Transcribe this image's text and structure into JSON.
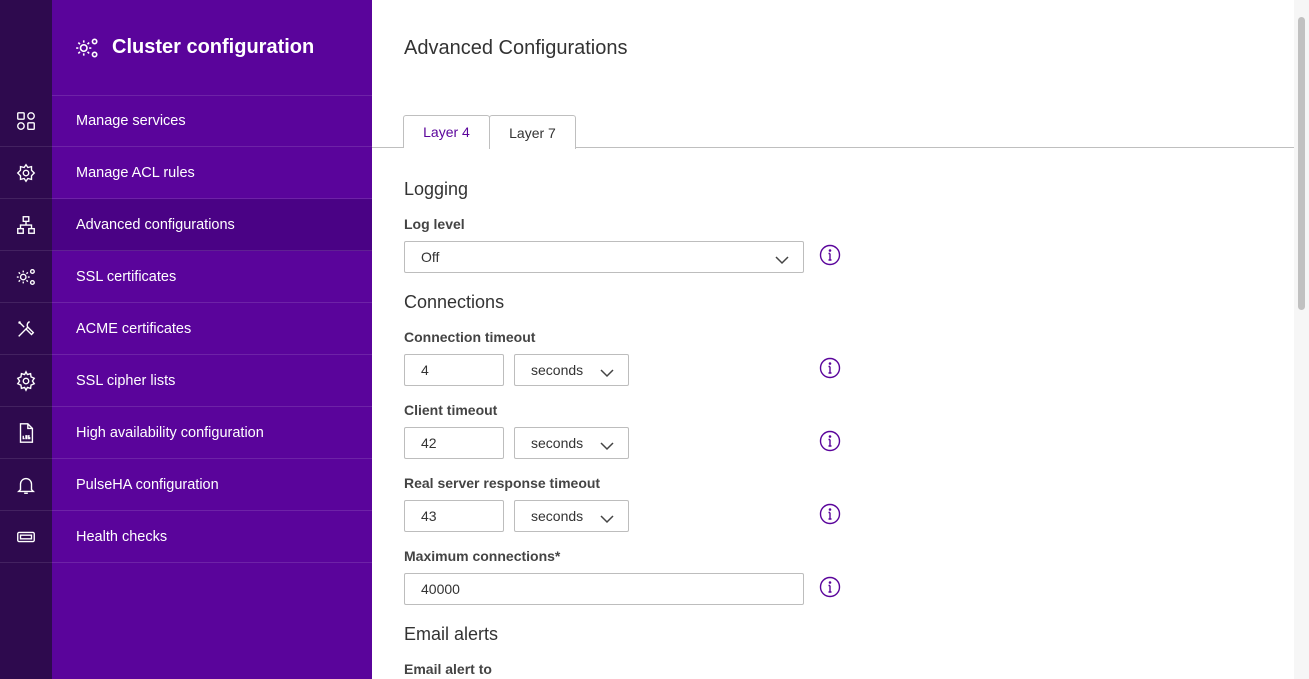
{
  "sidebar": {
    "title": "Cluster configuration",
    "items": [
      {
        "label": "Manage services",
        "icon": "grid-icon"
      },
      {
        "label": "Manage ACL rules",
        "icon": "acl-rules-icon"
      },
      {
        "label": "Advanced configurations",
        "icon": "network-icon",
        "active": true
      },
      {
        "label": "SSL certificates",
        "icon": "gears-icon"
      },
      {
        "label": "ACME certificates",
        "icon": "tools-icon"
      },
      {
        "label": "SSL cipher lists",
        "icon": "gear-icon"
      },
      {
        "label": "High availability configuration",
        "icon": "log-file-icon"
      },
      {
        "label": "PulseHA configuration",
        "icon": "bell-icon"
      },
      {
        "label": "Health checks",
        "icon": "ticket-icon"
      }
    ]
  },
  "main": {
    "title": "Advanced Configurations",
    "tabs": [
      {
        "label": "Layer 4"
      },
      {
        "label": "Layer 7",
        "active": true
      }
    ],
    "logging": {
      "section": "Logging",
      "log_level_label": "Log level",
      "log_level_value": "Off"
    },
    "connections": {
      "section": "Connections",
      "connection_timeout_label": "Connection timeout",
      "connection_timeout_value": "4",
      "connection_timeout_unit": "seconds",
      "client_timeout_label": "Client timeout",
      "client_timeout_value": "42",
      "client_timeout_unit": "seconds",
      "real_server_timeout_label": "Real server response timeout",
      "real_server_timeout_value": "43",
      "real_server_timeout_unit": "seconds",
      "max_connections_label": "Maximum connections*",
      "max_connections_value": "40000"
    },
    "email": {
      "section": "Email alerts",
      "email_to_label": "Email alert to"
    }
  },
  "colors": {
    "brand": "#5a049b",
    "rail": "#2e0a4e",
    "active_nav": "#4a0285"
  }
}
